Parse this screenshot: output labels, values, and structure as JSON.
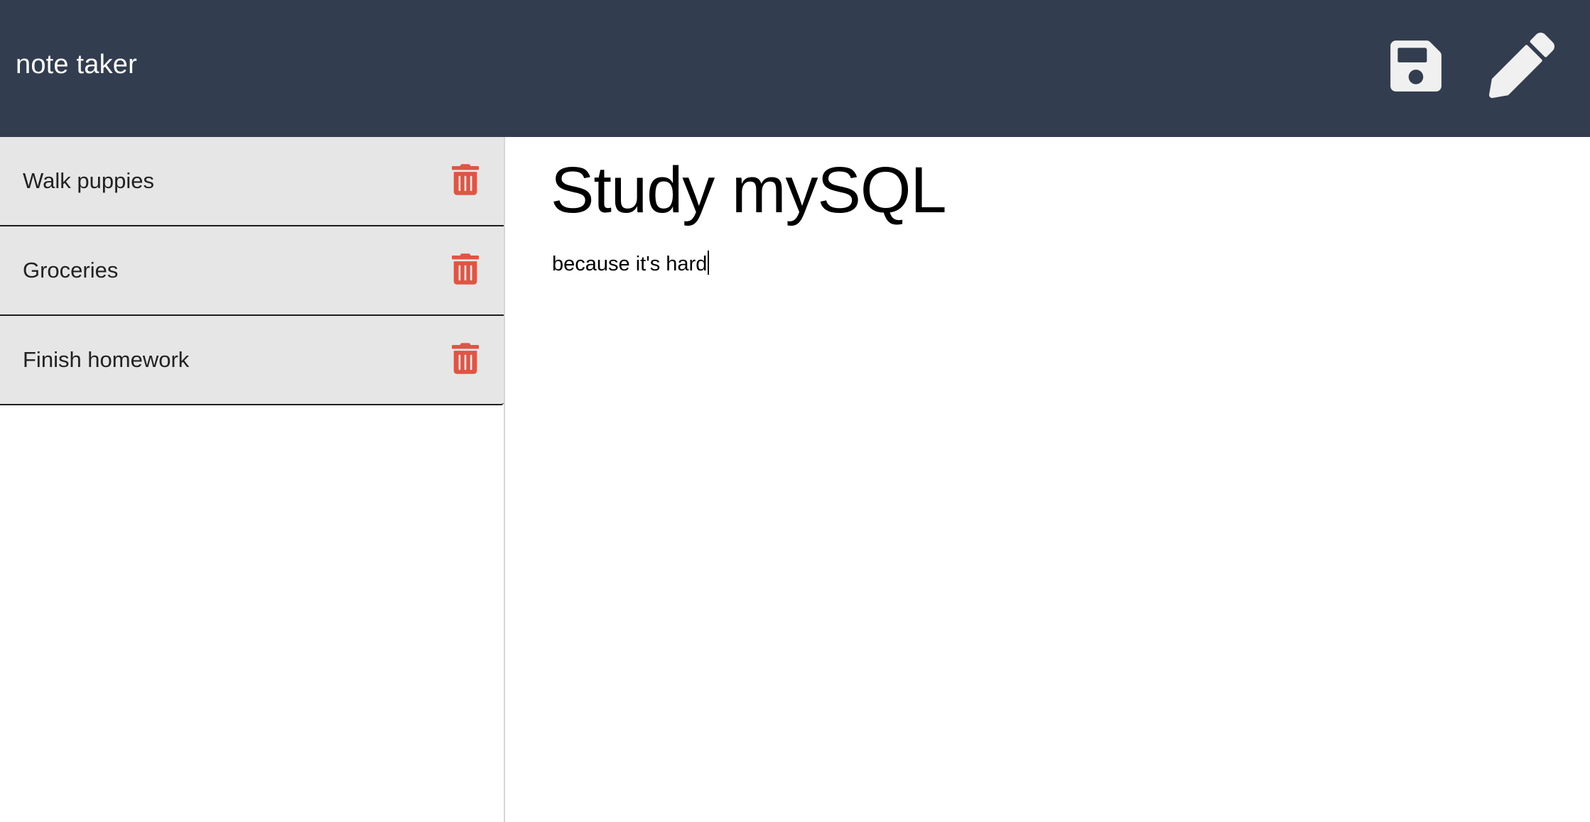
{
  "app": {
    "title": "note taker"
  },
  "toolbar": {
    "save_icon": "floppy-disk-icon",
    "new_icon": "pencil-icon",
    "icon_color": "#f0f0f0"
  },
  "notes": [
    {
      "title": "Walk puppies"
    },
    {
      "title": "Groceries"
    },
    {
      "title": "Finish homework"
    }
  ],
  "active_note": {
    "title": "Study mySQL",
    "body": "because it's hard"
  },
  "colors": {
    "navbar": "#323d4f",
    "list_item_bg": "#e6e6e6",
    "delete_icon": "#de5545"
  }
}
